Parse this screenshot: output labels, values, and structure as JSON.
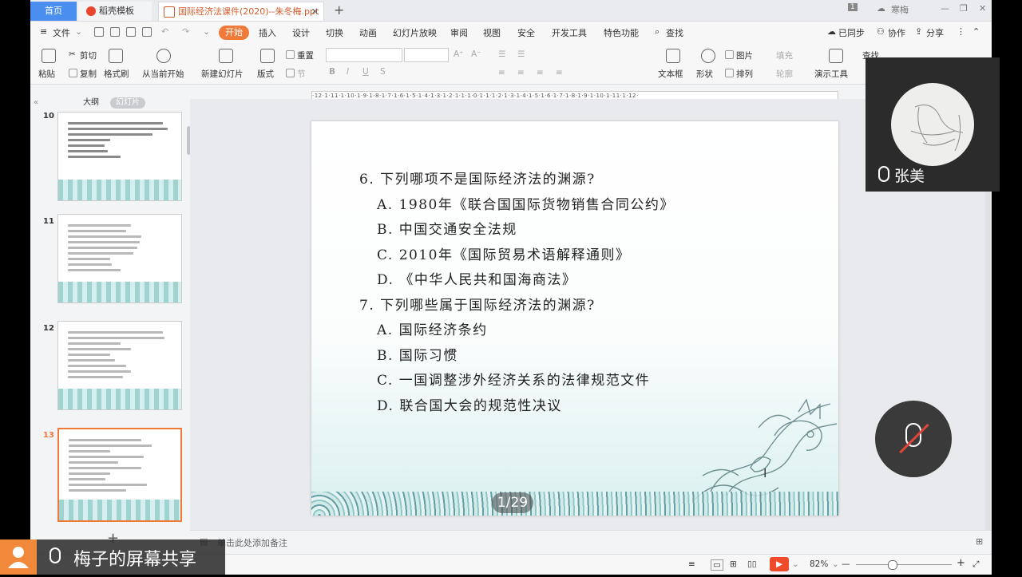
{
  "tabs": {
    "home": "首页",
    "templates": "稻壳模板",
    "document": "国际经济法课件(2020)--朱冬梅.ppt",
    "close": "✕",
    "add": "+"
  },
  "titlebar": {
    "badge": "1",
    "user": "寒梅"
  },
  "menu": {
    "file": "文件",
    "active": "开始",
    "items": [
      "插入",
      "设计",
      "切换",
      "动画",
      "幻灯片放映",
      "审阅",
      "视图",
      "安全",
      "开发工具",
      "特色功能"
    ],
    "search": "查找",
    "sync": "已同步",
    "collab": "协作",
    "share": "分享"
  },
  "ribbon": {
    "paste": "粘贴",
    "cut": "剪切",
    "copy": "复制",
    "format_painter": "格式刷",
    "from_current": "从当前开始",
    "new_slide": "新建幻灯片",
    "layout": "版式",
    "reset": "重置",
    "section": "节",
    "textbox": "文本框",
    "shape": "形状",
    "arrange": "排列",
    "picture": "图片",
    "fill": "填充",
    "outline": "轮廓",
    "present_tools": "演示工具",
    "find": "查找"
  },
  "ruler_text": "·12·1·11·1·10·1·9·1·8·1·7·1·6·1·5·1·4·1·3·1·2·1·1·1·0·1·1·1·2·1·3·1·4·1·5·1·6·1·7·1·8·1·9·1·10·1·11·1·12·",
  "leftpanel": {
    "outline_tab": "大纲",
    "slides_tab": "幻灯片",
    "thumbs": [
      {
        "num": "10",
        "selected": false
      },
      {
        "num": "11",
        "selected": false
      },
      {
        "num": "12",
        "selected": false
      },
      {
        "num": "13",
        "selected": true
      }
    ],
    "add": "+"
  },
  "slide": {
    "q6": "6. 下列哪项不是国际经济法的渊源?",
    "q6_options": [
      "A. 1980年《联合国国际货物销售合同公约》",
      "B. 中国交通安全法规",
      "C. 2010年《国际贸易术语解释通则》",
      "D. 《中华人民共和国海商法》"
    ],
    "q7": "7. 下列哪些属于国际经济法的渊源?",
    "q7_options": [
      "A. 国际经济条约",
      "B. 国际习惯",
      "C. 一国调整涉外经济关系的法律规范文件",
      "D. 联合国大会的规范性决议"
    ],
    "page_indicator": "1/29"
  },
  "notes": {
    "placeholder": "单击此处添加备注"
  },
  "status": {
    "zoom": "82%",
    "zoom_value": 0.82
  },
  "overlay": {
    "video_name": "张美",
    "share_label": "梅子的屏幕共享"
  },
  "colors": {
    "accent": "#f07a3a",
    "home_tab": "#4a8ff0",
    "overlay_bg": "#2b2b2b",
    "mute_slash": "#e0453a"
  }
}
